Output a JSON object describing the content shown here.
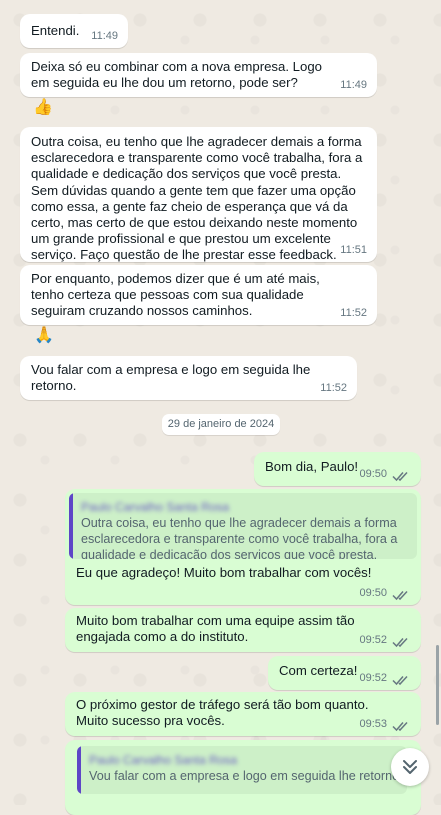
{
  "messages": [
    {
      "text": "Entendi.",
      "time": "11:49"
    },
    {
      "text": "Deixa só eu combinar com a nova empresa. Logo em seguida eu lhe dou um retorno, pode ser?",
      "time": "11:49"
    },
    {
      "text": "👍"
    },
    {
      "text": "Outra coisa, eu tenho que lhe agradecer demais a forma esclarecedora e transparente como você trabalha, fora a qualidade e dedicação dos serviços que você presta. Sem dúvidas quando a gente tem que fazer uma opção como essa, a gente faz cheio de esperança que vá da certo, mas certo de que estou deixando neste momento um grande profissional e que prestou um excelente serviço. Faço questão de lhe prestar esse feedback.",
      "time": "11:51"
    },
    {
      "text": "Por enquanto, podemos dizer que é um até mais, tenho certeza que pessoas com sua qualidade seguiram cruzando nossos caminhos.",
      "time": "11:52"
    },
    {
      "text": "🙏"
    },
    {
      "text": "Vou falar com a empresa e logo em seguida lhe retorno.",
      "time": "11:52"
    },
    {
      "text": "Bom dia, Paulo!",
      "time": "09:50"
    },
    {
      "quote_name": "Paulo Carvalho Santa Rosa",
      "quote_text": "Outra coisa, eu tenho que lhe agradecer demais a forma esclarecedora e transparente como você trabalha, fora a qualidade e dedicação dos serviços que você presta. Se…",
      "text": "Eu que agradeço! Muito bom trabalhar com vocês!",
      "time": "09:50"
    },
    {
      "text": "Muito bom trabalhar com uma equipe assim tão engajada como a do instituto.",
      "time": "09:52"
    },
    {
      "text": "Com certeza!",
      "time": "09:52"
    },
    {
      "text": "O próximo gestor de tráfego será tão bom quanto. Muito sucesso pra vocês.",
      "time": "09:53"
    },
    {
      "quote_name": "Paulo Carvalho Santa Rosa",
      "quote_text": "Vou falar com a empresa e logo em seguida lhe retorno"
    }
  ],
  "date_divider": "29 de janeiro de 2024",
  "colors": {
    "incoming": "#ffffff",
    "outgoing": "#d9fdd3",
    "tick_read": "#667781",
    "quote_bar": "#5e46c7"
  }
}
